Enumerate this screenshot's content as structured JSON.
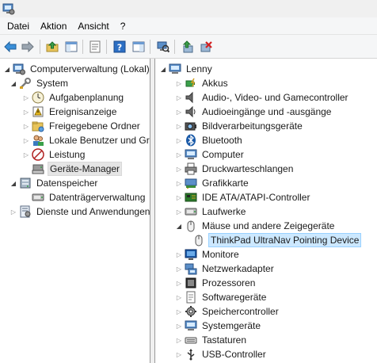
{
  "menubar": {
    "items": [
      "Datei",
      "Aktion",
      "Ansicht",
      "?"
    ]
  },
  "toolbar": {
    "buttons": [
      "back-icon",
      "forward-icon",
      "up-folder-icon",
      "show-hide-tree-icon",
      "properties-icon",
      "help-icon",
      "show-action-pane-icon",
      "scan-hardware-icon",
      "update-driver-icon",
      "uninstall-device-icon"
    ]
  },
  "left_tree": {
    "root": "Computerverwaltung (Lokal)",
    "system": "System",
    "aufgaben": "Aufgabenplanung",
    "ereignis": "Ereignisanzeige",
    "ordner": "Freigegebene Ordner",
    "benutzer": "Lokale Benutzer und Gruppen",
    "leistung": "Leistung",
    "geraete": "Geräte-Manager",
    "datenspeicher": "Datenspeicher",
    "datentraeger": "Datenträgerverwaltung",
    "dienste": "Dienste und Anwendungen"
  },
  "right_tree": {
    "root": "Lenny",
    "categories": [
      "Akkus",
      "Audio-, Video- und Gamecontroller",
      "Audioeingänge und -ausgänge",
      "Bildverarbeitungsgeräte",
      "Bluetooth",
      "Computer",
      "Druckwarteschlangen",
      "Grafikkarte",
      "IDE ATA/ATAPI-Controller",
      "Laufwerke",
      "Mäuse und andere Zeigegeräte"
    ],
    "selected_device": "ThinkPad UltraNav Pointing Device",
    "categories_after": [
      "Monitore",
      "Netzwerkadapter",
      "Prozessoren",
      "Softwaregeräte",
      "Speichercontroller",
      "Systemgeräte",
      "Tastaturen",
      "USB-Controller"
    ]
  },
  "colors": {
    "selection_blue": "#cce8ff",
    "selection_grey": "#e5e5e5",
    "toolbar_bg": "#f5f6f7"
  }
}
